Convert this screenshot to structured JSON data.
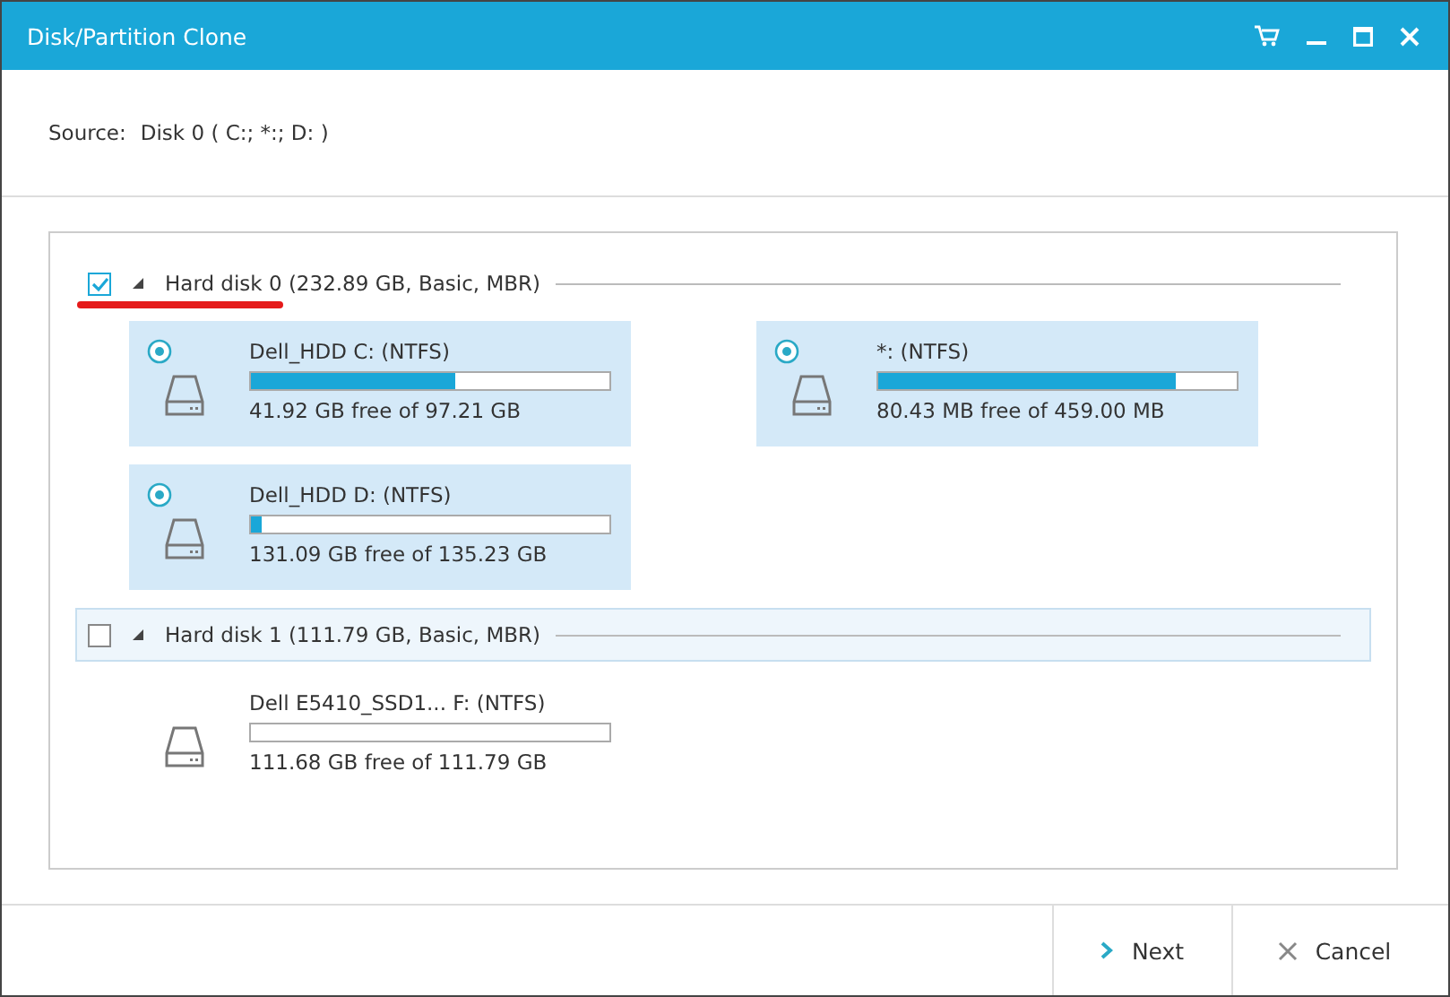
{
  "window": {
    "title": "Disk/Partition Clone"
  },
  "source": {
    "label": "Source:",
    "value": "Disk 0 ( C:; *:; D: )"
  },
  "disks": [
    {
      "label": "Hard disk 0 (232.89 GB, Basic, MBR)",
      "checked": true,
      "expanded": true,
      "highlighted": false,
      "underlined": true,
      "partitions": [
        {
          "name": "Dell_HDD C: (NTFS)",
          "level": 0.57,
          "free": "41.92 GB free of 97.21 GB",
          "selected": true
        },
        {
          "name": "*: (NTFS)",
          "level": 0.83,
          "free": "80.43 MB free of 459.00 MB",
          "selected": true
        },
        {
          "name": "Dell_HDD D: (NTFS)",
          "level": 0.03,
          "free": "131.09 GB free of 135.23 GB",
          "selected": true
        }
      ]
    },
    {
      "label": "Hard disk 1 (111.79 GB, Basic, MBR)",
      "checked": false,
      "expanded": true,
      "highlighted": true,
      "underlined": false,
      "partitions": [
        {
          "name": "Dell E5410_SSD1... F: (NTFS)",
          "level": 0.0,
          "free": "111.68 GB free of 111.79 GB",
          "selected": false
        }
      ]
    }
  ],
  "buttons": [
    {
      "label": "Next",
      "kind": "next"
    },
    {
      "label": "Cancel",
      "kind": "cancel"
    }
  ]
}
